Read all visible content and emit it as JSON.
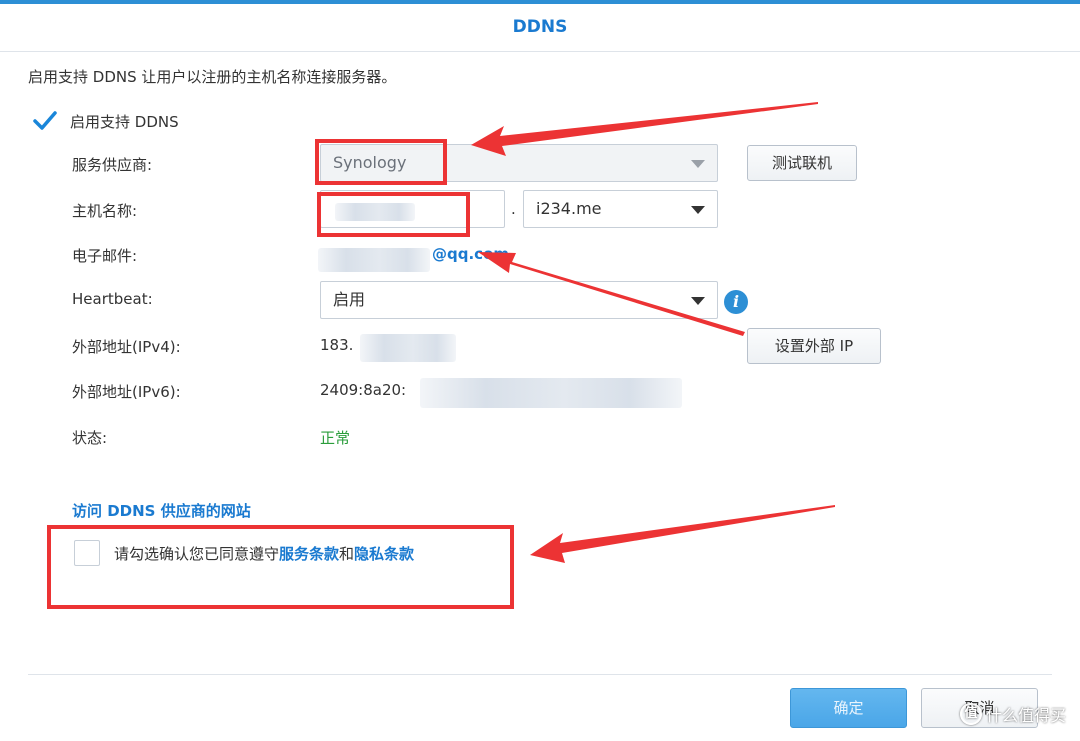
{
  "dialog": {
    "title": "DDNS"
  },
  "intro": "启用支持 DDNS 让用户以注册的主机名称连接服务器。",
  "enable": {
    "label": "启用支持 DDNS",
    "checked": true
  },
  "fields": {
    "provider": {
      "label": "服务供应商:",
      "value": "Synology"
    },
    "hostname": {
      "label": "主机名称:",
      "separator": ".",
      "domain": "i234.me"
    },
    "email": {
      "label": "电子邮件:",
      "suffix": "@qq.com"
    },
    "heartbeat": {
      "label": "Heartbeat:",
      "value": "启用"
    },
    "ipv4": {
      "label": "外部地址(IPv4):",
      "value_prefix": "183."
    },
    "ipv6": {
      "label": "外部地址(IPv6):",
      "value_prefix": "2409:8a20:"
    },
    "status": {
      "label": "状态:",
      "value": "正常"
    }
  },
  "buttons": {
    "test_connection": "测试联机",
    "set_external_ip": "设置外部 IP",
    "ok": "确定",
    "cancel": "取消"
  },
  "provider_site_link": "访问 DDNS 供应商的网站",
  "terms": {
    "prefix": "请勾选确认您已同意遵守",
    "service_terms": "服务条款",
    "and": "和",
    "privacy_terms": "隐私条款",
    "checked": false
  },
  "watermark": {
    "badge": "值",
    "text": "什么值得买"
  },
  "colors": {
    "accent": "#1a7ad0",
    "annotation": "#ec3334",
    "status_ok": "#2a9d3b",
    "primary_button": "#4aa6e8"
  }
}
